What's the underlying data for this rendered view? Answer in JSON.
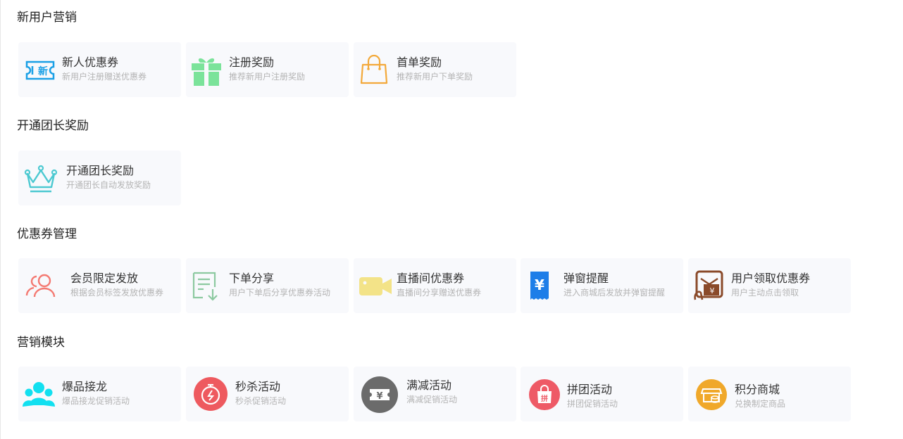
{
  "sections": [
    {
      "title": "新用户营销",
      "cards": [
        {
          "title": "新人优惠券",
          "desc": "新用户注册赠送优惠券",
          "icon": "new-coupon-icon",
          "color": "#1aa0e6"
        },
        {
          "title": "注册奖励",
          "desc": "推荐新用户注册奖励",
          "icon": "gift-icon",
          "color": "#7be39a"
        },
        {
          "title": "首单奖励",
          "desc": "推荐新用户下单奖励",
          "icon": "shopping-bag-icon",
          "color": "#f3a93a"
        }
      ]
    },
    {
      "title": "开通团长奖励",
      "cards": [
        {
          "title": "开通团长奖励",
          "desc": "开通团长自动发放奖励",
          "icon": "crown-icon",
          "color": "#4cc9d1"
        }
      ]
    },
    {
      "title": "优惠券管理",
      "cards": [
        {
          "title": "会员限定发放",
          "desc": "根据会员标签发放优惠券",
          "icon": "members-icon",
          "color": "#f47a72"
        },
        {
          "title": "下单分享",
          "desc": "用户下单后分享优惠券活动",
          "icon": "share-order-icon",
          "color": "#8cc9a0"
        },
        {
          "title": "直播间优惠券",
          "desc": "直播间分享赠送优惠券",
          "icon": "video-camera-icon",
          "color": "#f3e388"
        },
        {
          "title": "弹窗提醒",
          "desc": "进入商城后发放并弹窗提醒",
          "icon": "yen-ticket-icon",
          "color": "#1e7ee8"
        },
        {
          "title": "用户领取优惠券",
          "desc": "用户主动点击领取",
          "icon": "claim-coupon-icon",
          "color": "#8a4a2a"
        }
      ]
    },
    {
      "title": "营销模块",
      "cards": [
        {
          "title": "爆品接龙",
          "desc": "爆品接龙促销活动",
          "icon": "group-people-icon",
          "color": "#12e0f0"
        },
        {
          "title": "秒杀活动",
          "desc": "秒杀促销活动",
          "icon": "stopwatch-icon",
          "color": "#ee5a5f"
        },
        {
          "title": "满减活动",
          "desc": "满减促销活动",
          "icon": "yen-discount-icon",
          "color": "#6b6b6b"
        },
        {
          "title": "拼团活动",
          "desc": "拼团促销活动",
          "icon": "group-buy-bag-icon",
          "color": "#ee5a66"
        },
        {
          "title": "积分商城",
          "desc": "兑换制定商品",
          "icon": "points-store-icon",
          "color": "#f0a82a"
        }
      ]
    }
  ]
}
